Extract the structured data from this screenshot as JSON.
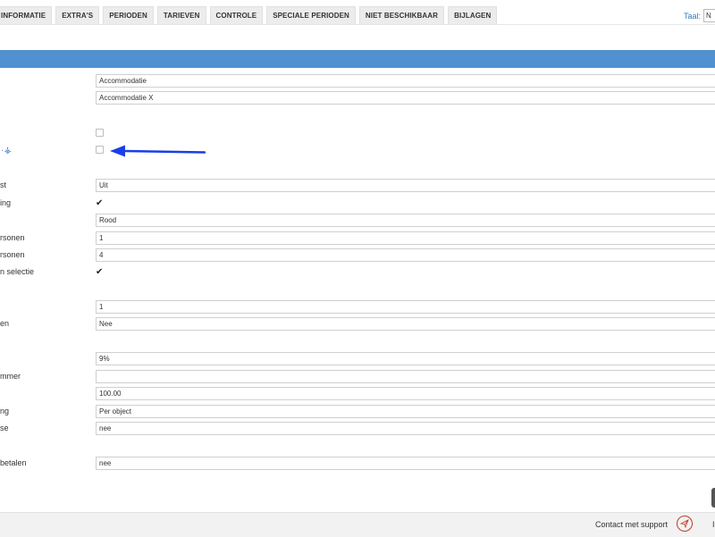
{
  "tabs": [
    "INFORMATIE",
    "EXTRA'S",
    "PERIODEN",
    "TARIEVEN",
    "CONTROLE",
    "SPECIALE PERIODEN",
    "NIET BESCHIKBAAR",
    "BIJLAGEN"
  ],
  "language": {
    "label": "Taal:",
    "value": "N"
  },
  "form": {
    "rows": [
      {
        "label": "",
        "value": "Accommodatie"
      },
      {
        "label": "",
        "value": "Accommodatie X"
      },
      {
        "label": "",
        "checked": false
      },
      {
        "label": "",
        "checked": false,
        "icon": "tree-icon"
      },
      {
        "label": "st",
        "value": "Uit"
      },
      {
        "label": "ing",
        "checked": true
      },
      {
        "label": "",
        "value": "Rood"
      },
      {
        "label": "rsonen",
        "value": "1"
      },
      {
        "label": "rsonen",
        "value": "4"
      },
      {
        "label": "n selectie",
        "checked": true
      },
      {
        "label": "",
        "value": "1"
      },
      {
        "label": "en",
        "value": "Nee"
      },
      {
        "label": "",
        "value": "9%"
      },
      {
        "label": "mmer",
        "value": ""
      },
      {
        "label": "",
        "value": "100.00"
      },
      {
        "label": "ng",
        "value": "Per object"
      },
      {
        "label": "se",
        "value": "nee"
      },
      {
        "label": "betalen",
        "value": "nee"
      }
    ]
  },
  "check_glyph": "✔",
  "footer": {
    "support_label": "Contact met support",
    "trailing": "I"
  },
  "colors": {
    "header_bar": "#5291cf",
    "arrow": "#1a3ee8",
    "link": "#337ab7"
  }
}
